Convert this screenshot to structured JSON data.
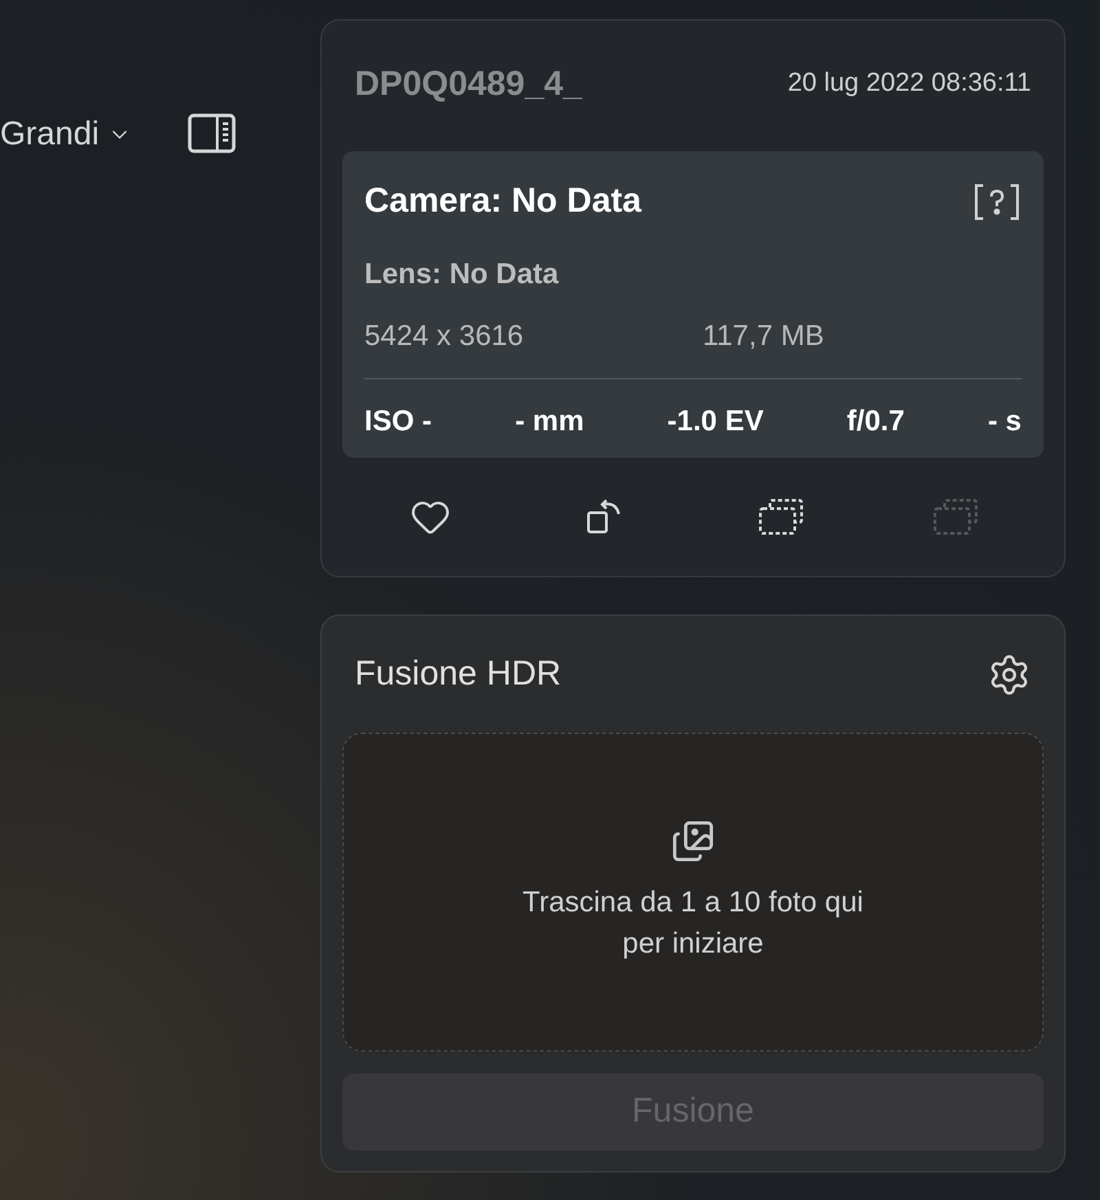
{
  "toolbar": {
    "view_menu": {
      "label": "Grandi"
    }
  },
  "info_card": {
    "filename": "DP0Q0489_4_",
    "date": "20 lug 2022 08:36:11",
    "camera": "Camera: No Data",
    "lens": "Lens: No Data",
    "dimensions": "5424 x 3616",
    "size": "117,7 MB",
    "exif": [
      "ISO -",
      "- mm",
      "-1.0 EV",
      "f/0.7",
      "- s"
    ],
    "actions": [
      {
        "kind": "favorite",
        "disabled": false
      },
      {
        "kind": "rotate",
        "disabled": false
      },
      {
        "kind": "stack",
        "disabled": false
      },
      {
        "kind": "stack",
        "disabled": true
      }
    ]
  },
  "hdr_card": {
    "title": "Fusione HDR",
    "drop_hint": "Trascina da 1 a 10 foto qui per iniziare",
    "button": {
      "label": "Fusione",
      "disabled": true
    }
  }
}
